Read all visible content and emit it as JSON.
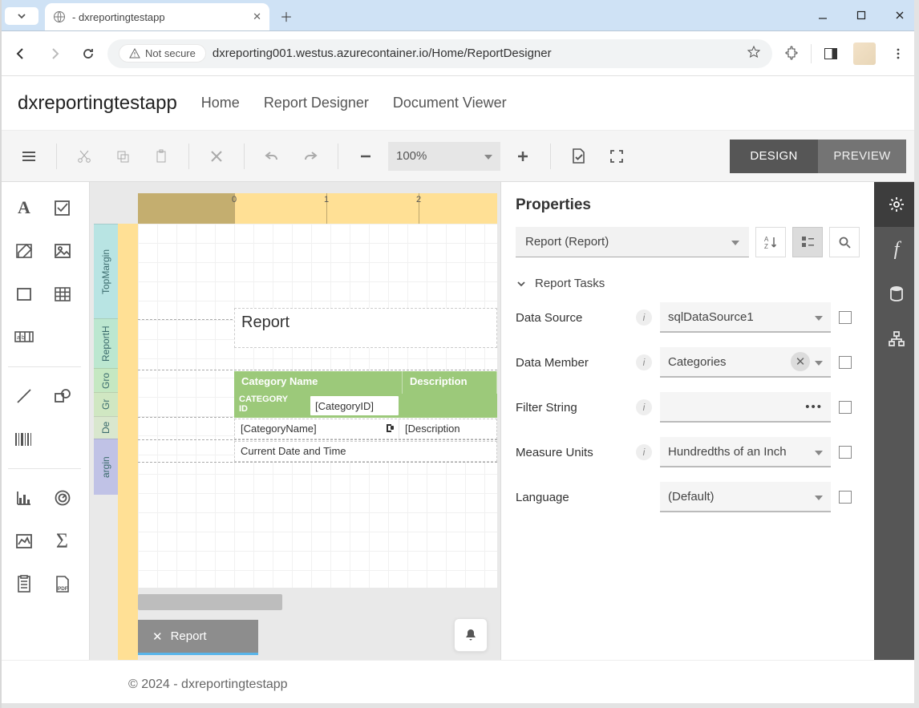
{
  "browser": {
    "tab_title": " - dxreportingtestapp",
    "url": "dxreporting001.westus.azurecontainer.io/Home/ReportDesigner",
    "not_secure_label": "Not secure"
  },
  "site": {
    "brand": "dxreportingtestapp",
    "links": [
      "Home",
      "Report Designer",
      "Document Viewer"
    ],
    "footer": "© 2024 - dxreportingtestapp"
  },
  "toolbar": {
    "zoom": "100%",
    "design": "DESIGN",
    "preview": "PREVIEW"
  },
  "canvas": {
    "ruler_marks": [
      "0",
      "1",
      "2"
    ],
    "bands": {
      "tm": "TopMargin",
      "rh": "ReportH",
      "gh": "Gro",
      "gr": "Gr",
      "de": "De",
      "bm": "argin"
    },
    "title": "Report",
    "columns": {
      "cat": "Category Name",
      "desc": "Description"
    },
    "group": {
      "label1": "CATEGORY",
      "label2": "ID",
      "field": "[CategoryID]"
    },
    "detail": {
      "cat": "[CategoryName]",
      "desc": "[Description"
    },
    "footer_text": "Current Date and Time",
    "tab_label": "Report"
  },
  "props": {
    "title": "Properties",
    "object": "Report (Report)",
    "section": "Report Tasks",
    "rows": {
      "datasource": {
        "label": "Data Source",
        "value": "sqlDataSource1"
      },
      "datamember": {
        "label": "Data Member",
        "value": "Categories"
      },
      "filter": {
        "label": "Filter String",
        "value": ""
      },
      "units": {
        "label": "Measure Units",
        "value": "Hundredths of an Inch"
      },
      "language": {
        "label": "Language",
        "value": "(Default)"
      }
    }
  }
}
